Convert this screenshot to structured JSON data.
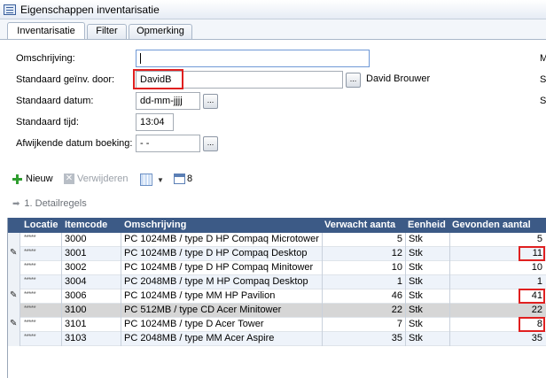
{
  "window": {
    "title": "Eigenschappen inventarisatie"
  },
  "tabs": [
    {
      "label": "Inventarisatie",
      "active": true
    },
    {
      "label": "Filter",
      "active": false
    },
    {
      "label": "Opmerking",
      "active": false
    }
  ],
  "form": {
    "omschrijving_label": "Omschrijving:",
    "omschrijving_value": "",
    "invdoor_label": "Standaard geïnv. door:",
    "invdoor_value": "DavidB",
    "invdoor_name": "David Brouwer",
    "datum_label": "Standaard datum:",
    "datum_value": "dd-mm-jjjj",
    "tijd_label": "Standaard tijd:",
    "tijd_value": "13:04",
    "afwijkend_label": "Afwijkende datum boeking:",
    "afwijkend_value": "-  -",
    "lookup_label": "...",
    "right_letters": [
      "M",
      "S",
      "S"
    ]
  },
  "toolbar": {
    "new_label": "Nieuw",
    "delete_label": "Verwijderen",
    "count": "8"
  },
  "section": {
    "label": "1. Detailregels"
  },
  "grid": {
    "columns": [
      "Locatie",
      "Itemcode",
      "Omschrijving",
      "Verwacht aanta",
      "Eenheid",
      "Gevonden aantal"
    ],
    "rows": [
      {
        "loc": "*****",
        "code": "3000",
        "desc": "PC 1024MB / type D HP Compaq Microtower",
        "expected": "5",
        "unit": "Stk",
        "found": "5",
        "edited": false,
        "highlight": false
      },
      {
        "loc": "*****",
        "code": "3001",
        "desc": "PC 1024MB / type D HP Compaq Desktop",
        "expected": "12",
        "unit": "Stk",
        "found": "11",
        "edited": true,
        "highlight": true
      },
      {
        "loc": "*****",
        "code": "3002",
        "desc": "PC 1024MB / type D HP Compaq Minitower",
        "expected": "10",
        "unit": "Stk",
        "found": "10",
        "edited": false,
        "highlight": false
      },
      {
        "loc": "*****",
        "code": "3004",
        "desc": "PC 2048MB / type M HP Compaq Desktop",
        "expected": "1",
        "unit": "Stk",
        "found": "1",
        "edited": false,
        "highlight": false
      },
      {
        "loc": "*****",
        "code": "3006",
        "desc": "PC 1024MB / type MM HP Pavilion",
        "expected": "46",
        "unit": "Stk",
        "found": "41",
        "edited": true,
        "highlight": true
      },
      {
        "loc": "*****",
        "code": "3100",
        "desc": "PC 512MB / type CD Acer Minitower",
        "expected": "22",
        "unit": "Stk",
        "found": "22",
        "edited": false,
        "highlight": false
      },
      {
        "loc": "*****",
        "code": "3101",
        "desc": "PC 1024MB / type D Acer Tower",
        "expected": "7",
        "unit": "Stk",
        "found": "8",
        "edited": true,
        "highlight": true
      },
      {
        "loc": "*****",
        "code": "3103",
        "desc": "PC 2048MB / type MM Acer Aspire",
        "expected": "35",
        "unit": "Stk",
        "found": "35",
        "edited": false,
        "highlight": false
      }
    ]
  },
  "colors": {
    "header_bg": "#3c5a86",
    "highlight_border": "#e02020",
    "selected_row": "#d6d6d6"
  }
}
